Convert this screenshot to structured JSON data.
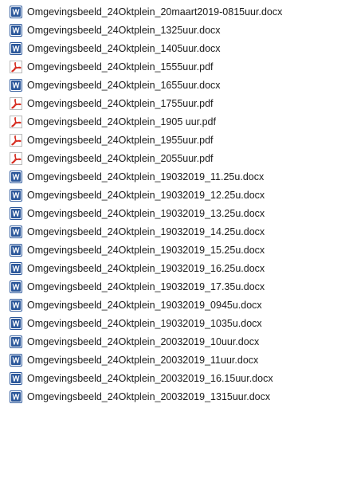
{
  "colors": {
    "word_icon": "#2b579a",
    "pdf_icon": "#d62b1f",
    "text": "#1a1a1a",
    "background": "#ffffff"
  },
  "files": [
    {
      "name": "Omgevingsbeeld_24Oktplein_20maart2019-0815uur.docx",
      "icon": "word-icon"
    },
    {
      "name": "Omgevingsbeeld_24Oktplein_1325uur.docx",
      "icon": "word-icon"
    },
    {
      "name": "Omgevingsbeeld_24Oktplein_1405uur.docx",
      "icon": "word-icon"
    },
    {
      "name": "Omgevingsbeeld_24Oktplein_1555uur.pdf",
      "icon": "pdf-icon"
    },
    {
      "name": "Omgevingsbeeld_24Oktplein_1655uur.docx",
      "icon": "word-icon"
    },
    {
      "name": "Omgevingsbeeld_24Oktplein_1755uur.pdf",
      "icon": "pdf-icon"
    },
    {
      "name": "Omgevingsbeeld_24Oktplein_1905 uur.pdf",
      "icon": "pdf-icon"
    },
    {
      "name": "Omgevingsbeeld_24Oktplein_1955uur.pdf",
      "icon": "pdf-icon"
    },
    {
      "name": "Omgevingsbeeld_24Oktplein_2055uur.pdf",
      "icon": "pdf-icon"
    },
    {
      "name": "Omgevingsbeeld_24Oktplein_19032019_11.25u.docx",
      "icon": "word-icon"
    },
    {
      "name": "Omgevingsbeeld_24Oktplein_19032019_12.25u.docx",
      "icon": "word-icon"
    },
    {
      "name": "Omgevingsbeeld_24Oktplein_19032019_13.25u.docx",
      "icon": "word-icon"
    },
    {
      "name": "Omgevingsbeeld_24Oktplein_19032019_14.25u.docx",
      "icon": "word-icon"
    },
    {
      "name": "Omgevingsbeeld_24Oktplein_19032019_15.25u.docx",
      "icon": "word-icon"
    },
    {
      "name": "Omgevingsbeeld_24Oktplein_19032019_16.25u.docx",
      "icon": "word-icon"
    },
    {
      "name": "Omgevingsbeeld_24Oktplein_19032019_17.35u.docx",
      "icon": "word-icon"
    },
    {
      "name": "Omgevingsbeeld_24Oktplein_19032019_0945u.docx",
      "icon": "word-icon"
    },
    {
      "name": "Omgevingsbeeld_24Oktplein_19032019_1035u.docx",
      "icon": "word-icon"
    },
    {
      "name": "Omgevingsbeeld_24Oktplein_20032019_10uur.docx",
      "icon": "word-icon"
    },
    {
      "name": "Omgevingsbeeld_24Oktplein_20032019_11uur.docx",
      "icon": "word-icon"
    },
    {
      "name": "Omgevingsbeeld_24Oktplein_20032019_16.15uur.docx",
      "icon": "word-icon"
    },
    {
      "name": "Omgevingsbeeld_24Oktplein_20032019_1315uur.docx",
      "icon": "word-icon"
    }
  ]
}
